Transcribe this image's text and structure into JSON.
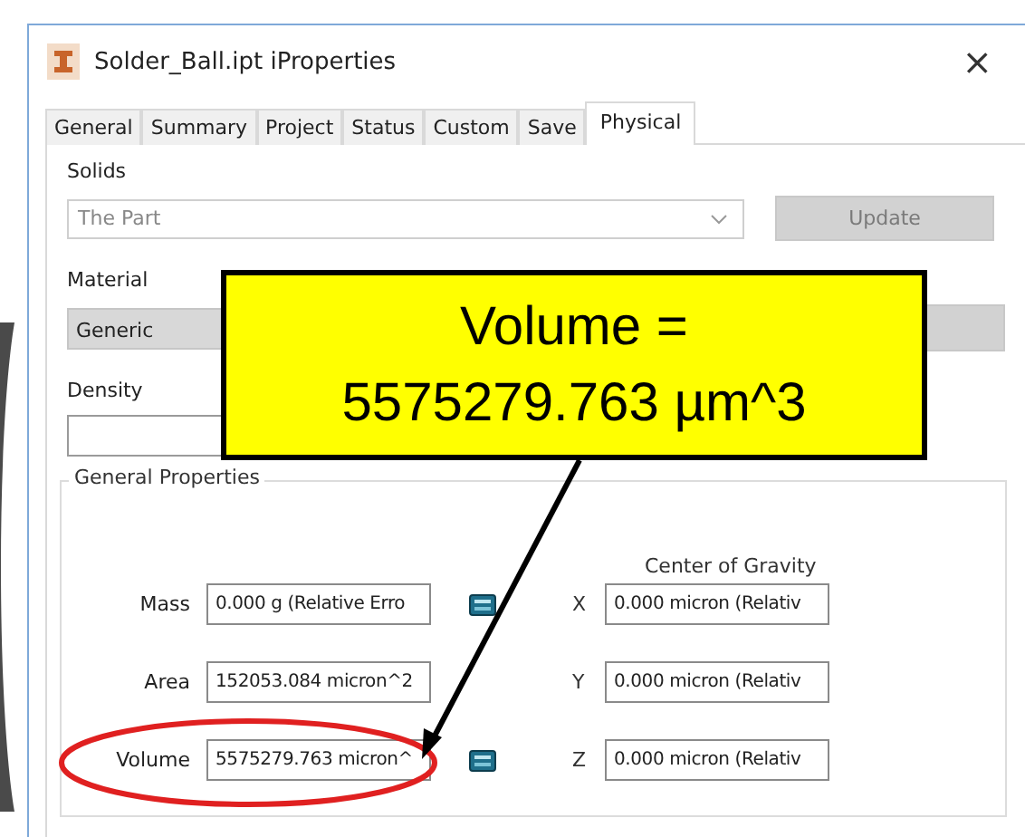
{
  "window": {
    "title": "Solder_Ball.ipt iProperties",
    "close": "×"
  },
  "tabs": [
    {
      "label": "General",
      "selected": false
    },
    {
      "label": "Summary",
      "selected": false
    },
    {
      "label": "Project",
      "selected": false
    },
    {
      "label": "Status",
      "selected": false
    },
    {
      "label": "Custom",
      "selected": false
    },
    {
      "label": "Save",
      "selected": false
    },
    {
      "label": "Physical",
      "selected": true
    }
  ],
  "solids": {
    "label": "Solids",
    "value": "The Part",
    "update_button": {
      "label": "Update",
      "disabled": true
    }
  },
  "material": {
    "label": "Material",
    "value": "Generic",
    "button": {
      "disabled": true
    }
  },
  "density": {
    "label": "Density"
  },
  "general_properties": {
    "title": "General Properties",
    "center_of_gravity": "Center of Gravity",
    "rows": [
      {
        "label": "Mass",
        "value": "0.000 g (Relative Erro",
        "calculator": true,
        "highlighted": false,
        "axis": "X",
        "axis_value": "0.000 micron (Relativ"
      },
      {
        "label": "Area",
        "value": "152053.084 micron^2",
        "calculator": false,
        "highlighted": false,
        "axis": "Y",
        "axis_value": "0.000 micron (Relativ"
      },
      {
        "label": "Volume",
        "value": "5575279.763 micron^",
        "calculator": true,
        "highlighted": true,
        "axis": "Z",
        "axis_value": "0.000 micron (Relativ"
      }
    ]
  },
  "callout": {
    "lines": [
      "Volume =",
      "5575279.763 µm^3"
    ]
  }
}
